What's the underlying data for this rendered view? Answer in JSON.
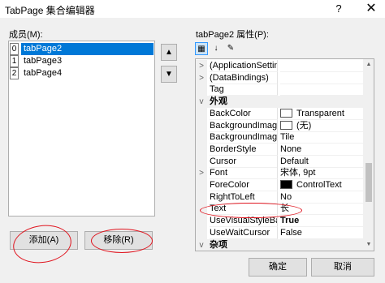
{
  "window": {
    "title": "TabPage 集合编辑器",
    "help_glyph": "?",
    "close_glyph": "✕"
  },
  "members": {
    "label": "成员(M):",
    "items": [
      {
        "index": "0",
        "name": "tabPage2",
        "selected": true
      },
      {
        "index": "1",
        "name": "tabPage3",
        "selected": false
      },
      {
        "index": "2",
        "name": "tabPage4",
        "selected": false
      }
    ],
    "move_up_icon": "arrow-up-icon",
    "move_down_icon": "arrow-down-icon"
  },
  "buttons": {
    "add": "添加(A)",
    "remove": "移除(R)",
    "ok": "确定",
    "cancel": "取消"
  },
  "properties": {
    "label": "tabPage2 属性(P):",
    "toolbar": [
      "categorized-icon",
      "alphabetical-icon",
      "property-pages-icon"
    ],
    "rows": [
      {
        "kind": "prop",
        "expand": ">",
        "name": "(ApplicationSettin",
        "value": ""
      },
      {
        "kind": "prop",
        "expand": ">",
        "name": "(DataBindings)",
        "value": ""
      },
      {
        "kind": "prop",
        "expand": "",
        "name": "Tag",
        "value": ""
      },
      {
        "kind": "cat",
        "expand": "v",
        "name": "外观",
        "value": ""
      },
      {
        "kind": "prop",
        "expand": "",
        "name": "BackColor",
        "value": "Transparent",
        "swatch": "#ffffff"
      },
      {
        "kind": "prop",
        "expand": "",
        "name": "BackgroundImage",
        "value": "(无)",
        "swatch": "#ffffff"
      },
      {
        "kind": "prop",
        "expand": "",
        "name": "BackgroundImage",
        "value": "Tile"
      },
      {
        "kind": "prop",
        "expand": "",
        "name": "BorderStyle",
        "value": "None"
      },
      {
        "kind": "prop",
        "expand": "",
        "name": "Cursor",
        "value": "Default"
      },
      {
        "kind": "prop",
        "expand": ">",
        "name": "Font",
        "value": "宋体, 9pt"
      },
      {
        "kind": "prop",
        "expand": "",
        "name": "ForeColor",
        "value": "ControlText",
        "swatch": "#000000"
      },
      {
        "kind": "prop",
        "expand": "",
        "name": "RightToLeft",
        "value": "No"
      },
      {
        "kind": "prop",
        "expand": "",
        "name": "Text",
        "value": "长"
      },
      {
        "kind": "prop",
        "expand": "",
        "name": "UseVisualStyleBac",
        "value": "True",
        "bold": true
      },
      {
        "kind": "prop",
        "expand": "",
        "name": "UseWaitCursor",
        "value": "False"
      },
      {
        "kind": "cat",
        "expand": "v",
        "name": "杂项",
        "value": ""
      }
    ]
  },
  "accent_color": "#0078d7",
  "annotation_color": "#e0141e"
}
